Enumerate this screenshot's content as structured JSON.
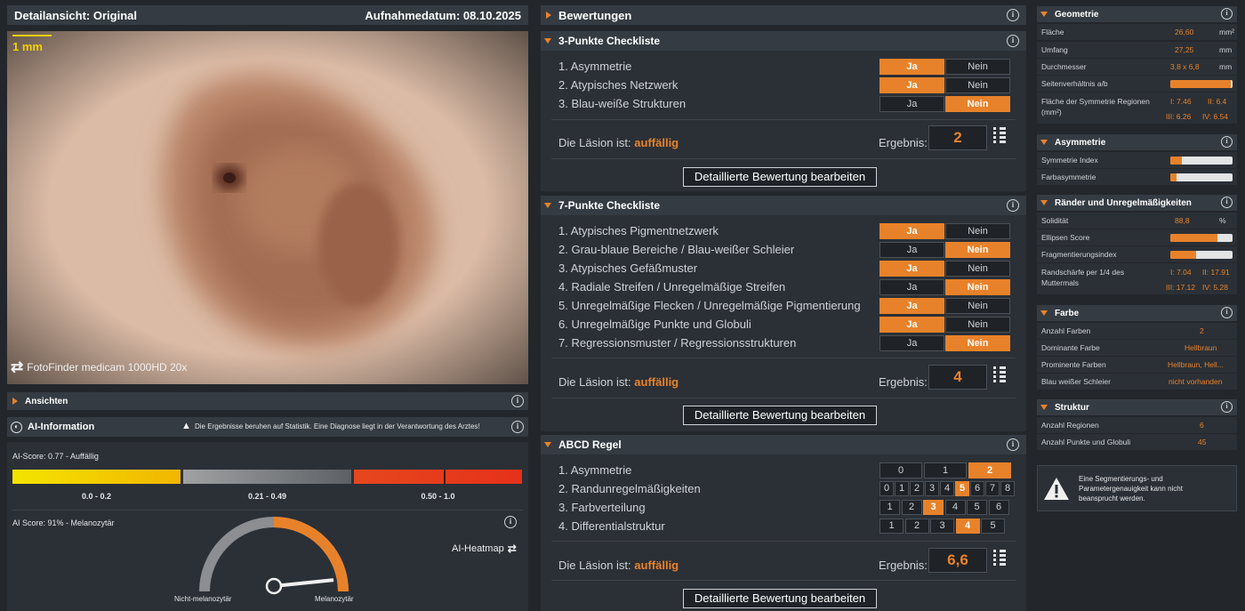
{
  "left": {
    "header_title": "Detailansicht: Original",
    "header_date": "Aufnahmedatum: 08.10.2025",
    "scale_label": "1 mm",
    "device_label": "FotoFinder medicam 1000HD 20x",
    "views_label": "Ansichten",
    "ai_title": "AI-Information",
    "ai_warning": "Die Ergebnisse beruhen auf Statistik. Eine Diagnose liegt in der Verantwortung des Arztes!",
    "ai_score_label": "AI-Score: 0.77 - Auffällig",
    "ai_score_value": 0.77,
    "bands": [
      {
        "label": "0.0 - 0.2",
        "color": "#f2d000"
      },
      {
        "label": "0.21 - 0.49",
        "color": "#8a8c8e"
      },
      {
        "label": "0.50 - 1.0",
        "color": "#e6471e"
      }
    ],
    "ai_score2_label": "AI Score: 91% - Melanozytär",
    "gauge_value": 0.91,
    "gauge_left_label": "Nicht-melanozytär",
    "gauge_right_label": "Melanozytär",
    "heatmap_label": "AI-Heatmap"
  },
  "middle": {
    "section_title": "Bewertungen",
    "three_point": {
      "title": "3-Punkte Checkliste",
      "items": [
        {
          "label": "1. Asymmetrie",
          "value": "Ja"
        },
        {
          "label": "2. Atypisches Netzwerk",
          "value": "Ja"
        },
        {
          "label": "3. Blau-weiße Strukturen",
          "value": "Nein"
        }
      ],
      "lesion_prefix": "Die Läsion ist:",
      "lesion_status": "auffällig",
      "result_label": "Ergebnis:",
      "result_value": "2",
      "edit_label": "Detaillierte Bewertung bearbeiten"
    },
    "seven_point": {
      "title": "7-Punkte Checkliste",
      "items": [
        {
          "label": "1. Atypisches Pigmentnetzwerk",
          "value": "Ja"
        },
        {
          "label": "2. Grau-blaue Bereiche / Blau-weißer Schleier",
          "value": "Nein"
        },
        {
          "label": "3. Atypisches Gefäßmuster",
          "value": "Ja"
        },
        {
          "label": "4. Radiale Streifen / Unregelmäßige Streifen",
          "value": "Nein"
        },
        {
          "label": "5. Unregelmäßige Flecken / Unregelmäßige Pigmentierung",
          "value": "Ja"
        },
        {
          "label": "6. Unregelmäßige Punkte und Globuli",
          "value": "Ja"
        },
        {
          "label": "7. Regressionsmuster / Regressionsstrukturen",
          "value": "Nein"
        }
      ],
      "lesion_prefix": "Die Läsion ist:",
      "lesion_status": "auffällig",
      "result_label": "Ergebnis:",
      "result_value": "4",
      "edit_label": "Detaillierte Bewertung bearbeiten"
    },
    "abcd": {
      "title": "ABCD Regel",
      "items": [
        {
          "label": "1. Asymmetrie",
          "options": [
            "0",
            "1",
            "2"
          ],
          "selected": "2"
        },
        {
          "label": "2. Randunregelmäßigkeiten",
          "options": [
            "0",
            "1",
            "2",
            "3",
            "4",
            "5",
            "6",
            "7",
            "8"
          ],
          "selected": "5"
        },
        {
          "label": "3. Farbverteilung",
          "options": [
            "1",
            "2",
            "3",
            "4",
            "5",
            "6"
          ],
          "selected": "3"
        },
        {
          "label": "4. Differentialstruktur",
          "options": [
            "1",
            "2",
            "3",
            "4",
            "5"
          ],
          "selected": "4"
        }
      ],
      "lesion_prefix": "Die Läsion ist:",
      "lesion_status": "auffällig",
      "result_label": "Ergebnis:",
      "result_value": "6,6",
      "edit_label": "Detaillierte Bewertung bearbeiten"
    },
    "yes_label": "Ja",
    "no_label": "Nein"
  },
  "right": {
    "geometrie": {
      "title": "Geometrie",
      "flaeche_label": "Fläche",
      "flaeche_value": "26,60",
      "flaeche_unit": "mm²",
      "umfang_label": "Umfang",
      "umfang_value": "27,25",
      "umfang_unit": "mm",
      "durchmesser_label": "Durchmesser",
      "durchmesser_value": "3,8 x 6,8",
      "durchmesser_unit": "mm",
      "seiten_label": "Seitenverhältnis a/b",
      "seiten_bar": 0.97,
      "sym_label": "Fläche der Symmetrie Regionen (mm²)",
      "sym_i": "I: 7.46",
      "sym_ii": "II: 6.4",
      "sym_iii": "III: 6.26",
      "sym_iv": "IV: 6.54"
    },
    "asymmetrie": {
      "title": "Asymmetrie",
      "sym_index_label": "Symmetrie Index",
      "sym_index_bar": 0.18,
      "farb_label": "Farbasymmetrie",
      "farb_bar": 0.1
    },
    "raender": {
      "title": "Ränder und Unregelmäßigkeiten",
      "solid_label": "Solidität",
      "solid_value": "88,8",
      "solid_unit": "%",
      "ellipsen_label": "Ellipsen Score",
      "ellipsen_bar": 0.75,
      "frag_label": "Fragmentierungsindex",
      "frag_bar": 0.42,
      "rand_label": "Randschärfe per 1/4 des Muttermals",
      "rand_i": "I: 7.04",
      "rand_ii": "II: 17.91",
      "rand_iii": "III: 17.12",
      "rand_iv": "IV: 5.28"
    },
    "farbe": {
      "title": "Farbe",
      "anzahl_label": "Anzahl Farben",
      "anzahl_value": "2",
      "dominant_label": "Dominante Farbe",
      "dominant_value": "Hellbraun",
      "prominent_label": "Prominente Farben",
      "prominent_value": "Hellbraun, Hell...",
      "schleier_label": "Blau weißer Schleier",
      "schleier_value": "nicht vorhanden"
    },
    "struktur": {
      "title": "Struktur",
      "regionen_label": "Anzahl Regionen",
      "regionen_value": "6",
      "punkte_label": "Anzahl Punkte und Globuli",
      "punkte_value": "45"
    },
    "warning_text": "Eine Segmentierungs- und Parametergenauigkeit kann nicht beansprucht werden."
  }
}
